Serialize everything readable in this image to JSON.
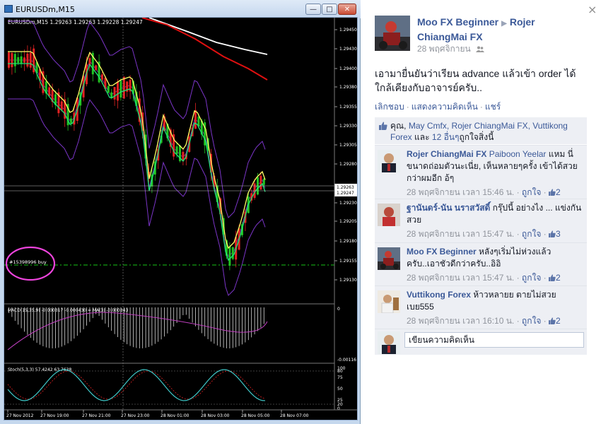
{
  "window": {
    "title": "EURUSDm,M15",
    "min_glyph": "—",
    "max_glyph": "□",
    "close_glyph": "✕"
  },
  "chart": {
    "symbol_label": "EURUSDm,M15  1.29263 1.29263 1.29228 1.29247",
    "price_ticks": [
      "1.29450",
      "1.29430",
      "1.29400",
      "1.29380",
      "1.29355",
      "1.29330",
      "1.29305",
      "1.29280",
      "1.29230",
      "1.29205",
      "1.29180",
      "1.29155",
      "1.29130"
    ],
    "bid_labels": [
      "1.29263",
      "1.29247"
    ],
    "order_label": "#15398996 buy",
    "macd_label": "MACD(15,35,9) -0.000317 -0.000430 = MA(3) -0.000343",
    "macd_ticks": [
      "0",
      "-0.00116"
    ],
    "stoch_label": "Stoch(5,3,3) 57.4242 63.7638",
    "stoch_ticks": [
      "100",
      "80",
      "75",
      "50",
      "25",
      "20",
      "0"
    ],
    "time_ticks": [
      "27 Nov 2012",
      "27 Nov 19:00",
      "27 Nov 21:00",
      "27 Nov 23:00",
      "28 Nov 01:00",
      "28 Nov 03:00",
      "28 Nov 05:00",
      "28 Nov 07:00"
    ],
    "colors": {
      "background": "#000000",
      "bull": "#22c322",
      "bear": "#e32222",
      "bands": "#7b35c8",
      "ma_yellow": "#ffff66",
      "ma_white": "#ffffff",
      "ma_red": "#e01010",
      "ma_green": "#1fe47a",
      "order_line": "#19c419",
      "highlight_circle": "#ee44dd",
      "stoch_main": "#3fc8c8",
      "stoch_signal": "#e02222"
    }
  },
  "fb": {
    "close_glyph": "×",
    "poster": "Moo FX Beginner",
    "arrow_glyph": "▶",
    "target": "Rojer ChiangMai FX",
    "date": "28 พฤศจิกายน",
    "audience_icon": "friends-icon",
    "post_text": "เอามายื่นยันว่าเรียน advance แล้วเข้า order ได้ใกล้เคียงกับอาจารย์ครับ..",
    "actions": {
      "unlike": "เลิกชอบ",
      "comment": "แสดงความคิดเห็น",
      "share": "แชร์",
      "sep": "·"
    },
    "likes": {
      "you": "คุณ,",
      "name1": "May Cmfx,",
      "name2": "Rojer ChiangMai FX,",
      "name3": "Vuttikong Forex",
      "and": "และ",
      "others": "12 อื่นๆ",
      "tail": "ถูกใจสิ่งนี้"
    },
    "comments": [
      {
        "name": "Rojer ChiangMai FX",
        "mention": "Paiboon Yeelar",
        "text": "แหม นี่ขนาดถ่อมตัวนะเนี่ย, เห็นหลายๆครั้ง เข้าได้สวยกว่าผมอีก อ้ๆ",
        "time": "28 พฤศจิกายน เวลา 15:46 น.",
        "like": "ถูกใจ",
        "count": "2"
      },
      {
        "name": "ฐานันดร์-นัน นราสวัสดิ์",
        "mention": "",
        "text": "กรุ๊ปนี้ อย่างไง ... แข่งกันสวย",
        "time": "28 พฤศจิกายน เวลา 15:47 น.",
        "like": "ถูกใจ",
        "count": "3"
      },
      {
        "name": "Moo FX Beginner",
        "mention": "",
        "text": "หลังๆเริ่มไม่ห่วงแล้วครับ..เอาชัวดีกว่าครับ..อิอิ",
        "time": "28 พฤศจิกายน เวลา 15:47 น.",
        "like": "ถูกใจ",
        "count": "2"
      },
      {
        "name": "Vuttikong Forex",
        "mention": "",
        "text": "ห้าวหลายย ตายไม่สวย เบย555",
        "time": "28 พฤศจิกายน เวลา 16:10 น.",
        "like": "ถูกใจ",
        "count": "2"
      }
    ],
    "reply_placeholder": "เขียนความคิดเห็น"
  }
}
